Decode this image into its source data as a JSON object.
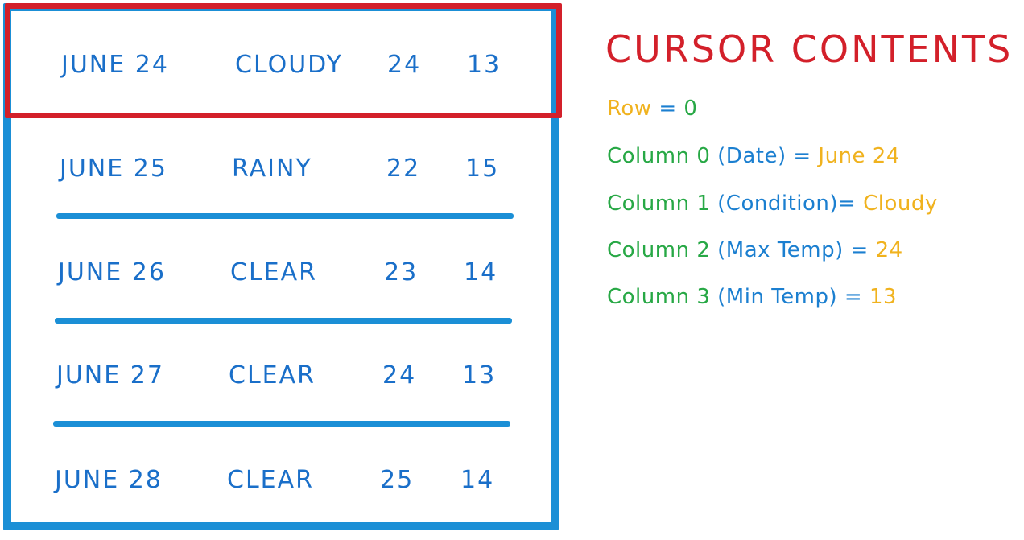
{
  "table": {
    "rows": [
      {
        "date": "JUNE 24",
        "condition": "CLOUDY",
        "max": "24",
        "min": "13"
      },
      {
        "date": "JUNE 25",
        "condition": "RAINY",
        "max": "22",
        "min": "15"
      },
      {
        "date": "JUNE 26",
        "condition": "CLEAR",
        "max": "23",
        "min": "14"
      },
      {
        "date": "JUNE 27",
        "condition": "CLEAR",
        "max": "24",
        "min": "13"
      },
      {
        "date": "JUNE 28",
        "condition": "CLEAR",
        "max": "25",
        "min": "14"
      }
    ],
    "colors": {
      "frame": "#1b8fd6",
      "cursor": "#d3202a",
      "text": "#1a6fc9"
    }
  },
  "panel": {
    "title": "CURSOR CONTENTS",
    "row_line": {
      "label": "Row",
      "eq": "=",
      "value": "0"
    },
    "columns": [
      {
        "label": "Column 0",
        "paren": "(Date)",
        "eq": "=",
        "value": "June 24"
      },
      {
        "label": "Column 1",
        "paren": "(Condition)",
        "eq": "=",
        "value": "Cloudy"
      },
      {
        "label": "Column 2",
        "paren": "(Max Temp)",
        "eq": "=",
        "value": "24"
      },
      {
        "label": "Column 3",
        "paren": "(Min Temp)",
        "eq": "=",
        "value": "13"
      }
    ],
    "colors": {
      "title": "#d3202a",
      "label": "#27a845",
      "paren": "#1b7fd0",
      "value": "#f0b21e"
    }
  }
}
